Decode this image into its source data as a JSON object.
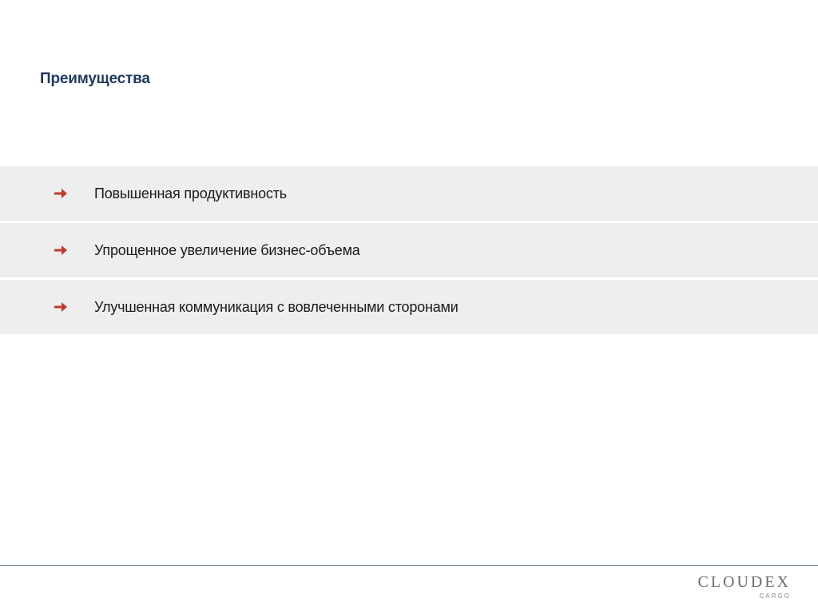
{
  "title": "Преимущества",
  "bullets": [
    {
      "text": "Повышенная продуктивность"
    },
    {
      "text": "Упрощенное увеличение бизнес-объема"
    },
    {
      "text": "Улучшенная коммуникация с вовлеченными сторонами"
    }
  ],
  "logo": {
    "main": "CLOUDEX",
    "sub": "CARGO"
  },
  "colors": {
    "title": "#1f3a5f",
    "arrow": "#c0392b",
    "bullet_bg": "#eeeeee",
    "footer_line": "#7a8ca0",
    "logo": "#6b6b6b"
  }
}
